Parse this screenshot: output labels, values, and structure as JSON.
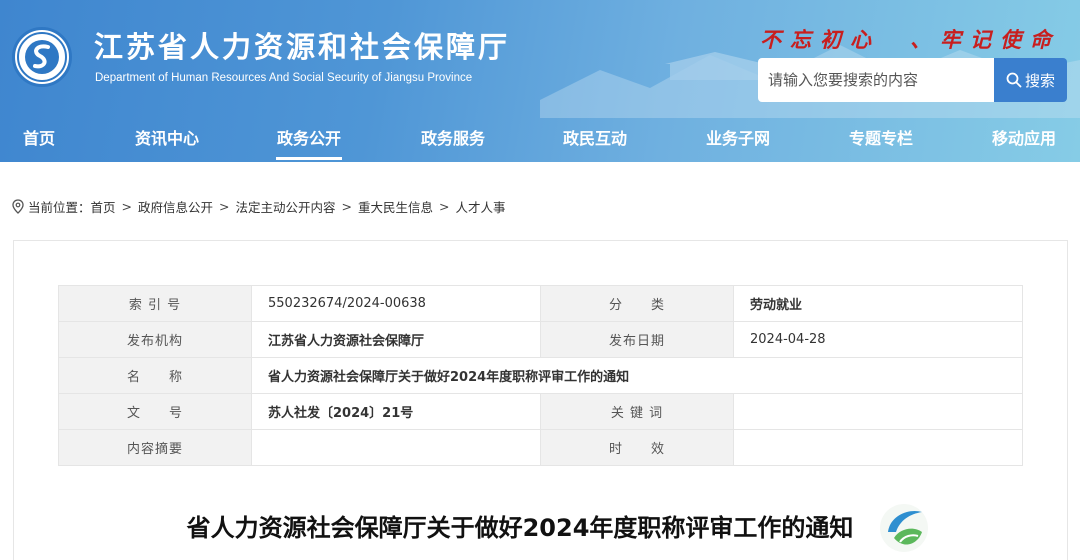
{
  "header": {
    "title": "江苏省人力资源和社会保障厅",
    "subtitle": "Department of Human Resources And Social Security of Jiangsu Province",
    "slogan": "不忘初心　、牢记使命",
    "search": {
      "placeholder": "请输入您要搜索的内容",
      "button_label": "搜索"
    }
  },
  "nav": {
    "items": [
      {
        "label": "首页",
        "active": false
      },
      {
        "label": "资讯中心",
        "active": false
      },
      {
        "label": "政务公开",
        "active": true
      },
      {
        "label": "政务服务",
        "active": false
      },
      {
        "label": "政民互动",
        "active": false
      },
      {
        "label": "业务子网",
        "active": false
      },
      {
        "label": "专题专栏",
        "active": false
      },
      {
        "label": "移动应用",
        "active": false
      }
    ]
  },
  "breadcrumb": {
    "prefix": "当前位置：",
    "items": [
      "首页",
      "政府信息公开",
      "法定主动公开内容",
      "重大民生信息",
      "人才人事"
    ],
    "separator": ">"
  },
  "info": {
    "index_label": "索 引 号",
    "index_value": "550232674/2024-00638",
    "category_label": "分　　类",
    "category_value": "劳动就业",
    "publisher_label": "发布机构",
    "publisher_value": "江苏省人力资源社会保障厅",
    "date_label": "发布日期",
    "date_value": "2024-04-28",
    "name_label": "名　　称",
    "name_value": "省人力资源社会保障厅关于做好2024年度职称评审工作的通知",
    "docno_label": "文　　号",
    "docno_value": "苏人社发〔2024〕21号",
    "keywords_label": "关 键 词",
    "keywords_value": "",
    "summary_label": "内容摘要",
    "summary_value": "",
    "validity_label": "时　　效",
    "validity_value": ""
  },
  "article": {
    "title": "省人力资源社会保障厅关于做好2024年度职称评审工作的通知"
  },
  "colors": {
    "header_blue": "#4a90d4",
    "search_button": "#3a7fce",
    "slogan_red": "#c81e1e",
    "label_cell_bg": "#f2f2f2"
  },
  "icons": {
    "logo": "ministry-emblem",
    "search": "magnifier",
    "location": "map-pin",
    "watermark": "leaf-logo"
  }
}
